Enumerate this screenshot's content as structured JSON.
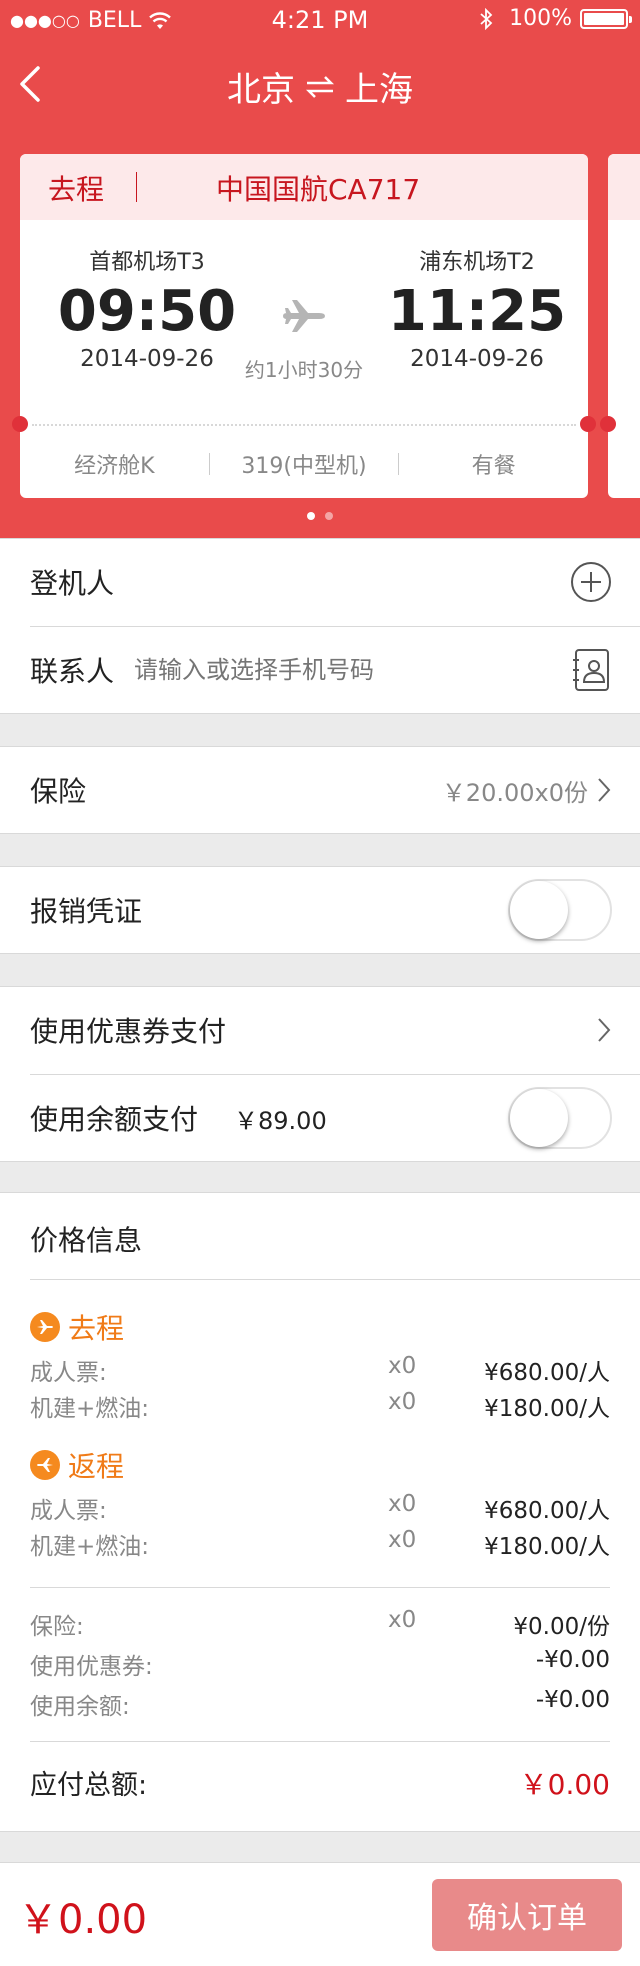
{
  "status_bar": {
    "signal": "●●●○○",
    "carrier": "BELL",
    "time": "4:21 PM",
    "battery": "100%"
  },
  "nav": {
    "from_city": "北京",
    "to_city": "上海"
  },
  "flight_card": {
    "trip_label": "去程",
    "flight_no": "中国国航CA717",
    "dep_airport": "首都机场T3",
    "dep_time": "09:50",
    "dep_date": "2014-09-26",
    "arr_airport": "浦东机场T2",
    "arr_time": "11:25",
    "arr_date": "2014-09-26",
    "duration": "约1小时30分",
    "cabin": "经济舱K",
    "aircraft": "319(中型机)",
    "meal": "有餐"
  },
  "passengers": {
    "boarding_label": "登机人",
    "contact_label": "联系人",
    "contact_placeholder": "请输入或选择手机号码"
  },
  "insurance": {
    "label": "保险",
    "value": "￥20.00x0份"
  },
  "receipt": {
    "label": "报销凭证",
    "toggle_on": false
  },
  "payment": {
    "coupon_label": "使用优惠券支付",
    "balance_label": "使用余额支付",
    "balance_value": "￥89.00",
    "balance_toggle_on": false
  },
  "price_info": {
    "title": "价格信息",
    "outbound": {
      "label": "去程",
      "rows": [
        {
          "label": "成人票:",
          "qty": "x0",
          "value": "¥680.00/人"
        },
        {
          "label": "机建+燃油:",
          "qty": "x0",
          "value": "¥180.00/人"
        }
      ]
    },
    "return": {
      "label": "返程",
      "rows": [
        {
          "label": "成人票:",
          "qty": "x0",
          "value": "¥680.00/人"
        },
        {
          "label": "机建+燃油:",
          "qty": "x0",
          "value": "¥180.00/人"
        }
      ]
    },
    "extras": [
      {
        "label": "保险:",
        "qty": "x0",
        "value": "¥0.00/份"
      },
      {
        "label": "使用优惠券:",
        "qty": "",
        "value": "-¥0.00"
      },
      {
        "label": "使用余额:",
        "qty": "",
        "value": "-¥0.00"
      }
    ],
    "total_label": "应付总额:",
    "total_value": "￥0.00"
  },
  "bottom_bar": {
    "total": "￥0.00",
    "confirm_label": "确认订单"
  },
  "colors": {
    "brand_red": "#e94b4b",
    "accent_red": "#d0121b",
    "orange": "#f07b18",
    "button_disabled": "#e88a8a"
  }
}
